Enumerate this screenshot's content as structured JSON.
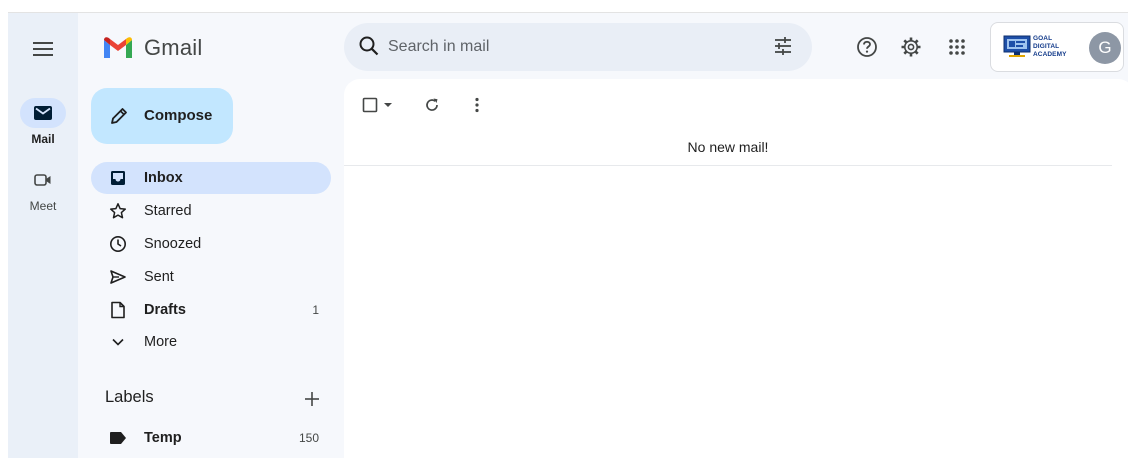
{
  "app": {
    "name": "Gmail",
    "accent_color": "#0b57d0",
    "compose_color": "#c2e7ff",
    "active_nav_color": "#d3e3fd"
  },
  "rail": {
    "items": [
      {
        "label": "Mail",
        "icon": "mail-icon",
        "active": true
      },
      {
        "label": "Meet",
        "icon": "video-icon",
        "active": false
      }
    ]
  },
  "search": {
    "placeholder": "Search in mail",
    "value": ""
  },
  "account": {
    "org_logo_text": "GOAL DIGITAL ACADEMY",
    "avatar_letter": "G"
  },
  "compose": {
    "label": "Compose"
  },
  "nav": {
    "items": [
      {
        "label": "Inbox",
        "icon": "inbox-icon",
        "count": "",
        "active": true,
        "bold": true
      },
      {
        "label": "Starred",
        "icon": "star-icon",
        "count": "",
        "active": false,
        "bold": false
      },
      {
        "label": "Snoozed",
        "icon": "clock-icon",
        "count": "",
        "active": false,
        "bold": false
      },
      {
        "label": "Sent",
        "icon": "send-icon",
        "count": "",
        "active": false,
        "bold": false
      },
      {
        "label": "Drafts",
        "icon": "draft-icon",
        "count": "1",
        "active": false,
        "bold": true
      },
      {
        "label": "More",
        "icon": "chevron-down-icon",
        "count": "",
        "active": false,
        "bold": false
      }
    ]
  },
  "labels": {
    "heading": "Labels",
    "items": [
      {
        "label": "Temp",
        "icon": "label-icon",
        "count": "150"
      }
    ]
  },
  "main": {
    "empty_message": "No new mail!"
  }
}
